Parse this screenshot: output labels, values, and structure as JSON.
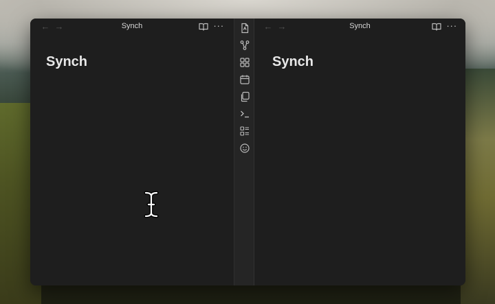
{
  "left_pane": {
    "tab_title": "Synch",
    "heading": "Synch",
    "back_icon": "arrow-left-icon",
    "forward_icon": "arrow-right-icon",
    "reading_view_icon": "book-open-icon",
    "more_icon": "more-options-icon"
  },
  "right_pane": {
    "tab_title": "Synch",
    "heading": "Synch",
    "back_icon": "arrow-left-icon",
    "forward_icon": "arrow-right-icon",
    "reading_view_icon": "book-open-icon",
    "more_icon": "more-options-icon"
  },
  "ribbon": {
    "icons": [
      "note-icon",
      "graph-view-icon",
      "canvas-icon",
      "daily-note-icon",
      "templates-icon",
      "command-palette-icon",
      "checklist-icon",
      "smiley-icon"
    ]
  },
  "cursor": "text-cursor-icon",
  "colors": {
    "window_bg": "#1e1e1e",
    "ribbon_bg": "#252525",
    "heading": "#e8e8e8"
  }
}
